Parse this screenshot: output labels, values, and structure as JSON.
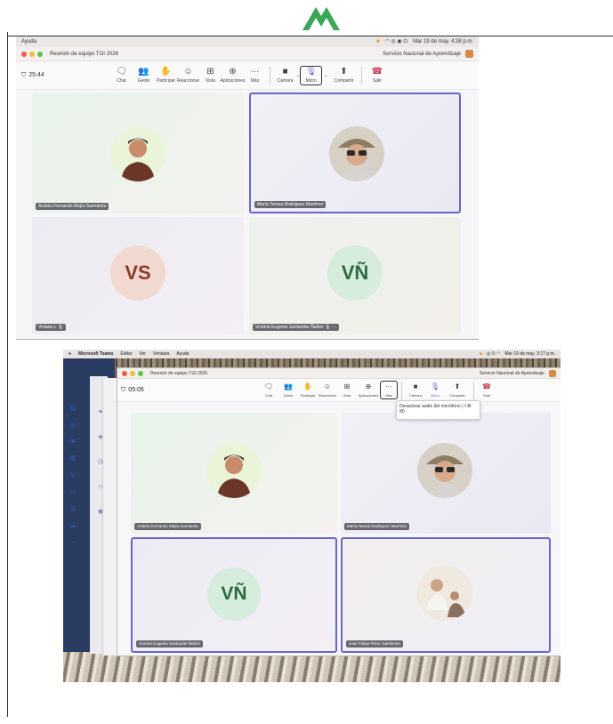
{
  "colors": {
    "logo_green": "#3aa657",
    "accent_purple": "#6a66c8",
    "leave_red": "#c4314b",
    "vs_bg": "#f2d9cf",
    "vs_text": "#8a3b2a",
    "vn_bg": "#d6ecdc",
    "vn_text": "#2e6b41"
  },
  "shot1": {
    "menu_app": "Ayuda",
    "menu_clock": "Mar 19 de may. 4:38 p.m.",
    "window_title": "Reunión de equipo TGI 2026",
    "org_name": "Servicio Nacional de Aprendizaje",
    "timer": "25:44",
    "toolbar": [
      {
        "icon": "chat-icon",
        "glyph": "💬",
        "label": "Chat"
      },
      {
        "icon": "people-icon",
        "glyph": "👥",
        "label": "Gente"
      },
      {
        "icon": "hand-icon",
        "glyph": "✋",
        "label": "Participar"
      },
      {
        "icon": "emoji-icon",
        "glyph": "☺",
        "label": "Reaccionar"
      },
      {
        "icon": "view-icon",
        "glyph": "⊞",
        "label": "Vista"
      },
      {
        "icon": "apps-icon",
        "glyph": "⊕",
        "label": "Aplicaciones"
      },
      {
        "icon": "more-icon",
        "glyph": "···",
        "label": "Más"
      }
    ],
    "camera_label": "Cámara",
    "mic_label": "Micro",
    "share_label": "Compartir",
    "leave_label": "Salir",
    "participants": [
      {
        "name": "Andrés Fernando Mejía Sarmiento"
      },
      {
        "name": "María Teresa Rodríguez Martínez"
      },
      {
        "initials": "VS",
        "name": "Viviana L"
      },
      {
        "initials": "VÑ",
        "name": "Victoria Eugenia Santander Ñañez"
      }
    ]
  },
  "shot2": {
    "menu_items": [
      "Microsoft Teams",
      "Editar",
      "Ver",
      "Ventana",
      "Ayuda"
    ],
    "menu_clock": "Mar 19 de may. 3:17 p.m.",
    "window_title": "Reunión de equipo TGI 2026",
    "org_name": "Servicio Nacional de Aprendizaje",
    "timer": "05:05",
    "toolbar": [
      {
        "icon": "chat-icon",
        "glyph": "💬",
        "label": "Chat"
      },
      {
        "icon": "people-icon",
        "glyph": "👥",
        "label": "Gente"
      },
      {
        "icon": "hand-icon",
        "glyph": "✋",
        "label": "Participar"
      },
      {
        "icon": "emoji-icon",
        "glyph": "☺",
        "label": "Reaccionar"
      },
      {
        "icon": "view-icon",
        "glyph": "⊞",
        "label": "Vista"
      },
      {
        "icon": "apps-icon",
        "glyph": "⊕",
        "label": "Aplicaciones"
      },
      {
        "icon": "more-icon",
        "glyph": "···",
        "label": "Más"
      }
    ],
    "camera_label": "Cámara",
    "mic_label": "Micro",
    "share_label": "Compartir",
    "leave_label": "Salir",
    "tooltip": "Desactivar audio del micrófono (⇧⌘ M)",
    "participants": [
      {
        "name": "Andrés Fernando Mejía Sarmiento"
      },
      {
        "name": "María Teresa Rodríguez Martínez"
      },
      {
        "initials": "VÑ",
        "name": "Victoria Eugenia Santander Ñañez"
      },
      {
        "name": "Juan Felipe Pérez Sarmiento"
      }
    ]
  }
}
